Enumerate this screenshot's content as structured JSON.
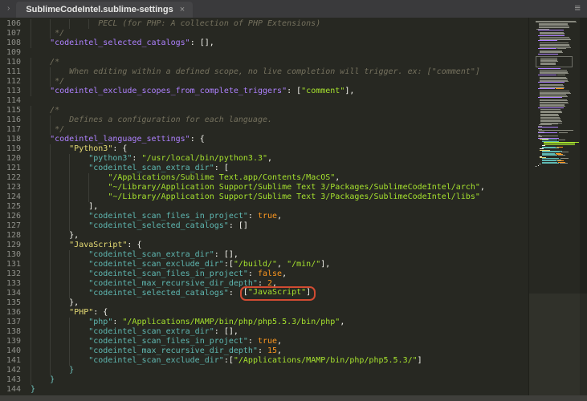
{
  "window": {
    "tab": {
      "title": "SublimeCodeIntel.sublime-settings",
      "close_glyph": "×"
    },
    "sidebar_chevron_glyph": "›",
    "overflow_icon_glyph": "≡"
  },
  "colors": {
    "editor_bg": "#272822",
    "tabbar_bg": "#3a3a3c",
    "comment": "#75715e",
    "key_top_level": "#ae81ff",
    "language_name": "#e6db74",
    "key_nested": "#5fb8b2",
    "string": "#a6e22e",
    "constant": "#fd971f",
    "punctuation": "#f8f8f2",
    "annotation_box": "#d14b32",
    "line_number": "#8f908a"
  },
  "editor": {
    "lines": [
      {
        "n": 106,
        "segs": [
          [
            "              PECL (for PHP: A collection of PHP Extensions)",
            "comment"
          ]
        ]
      },
      {
        "n": 107,
        "segs": [
          [
            "     */",
            "comment"
          ]
        ]
      },
      {
        "n": 108,
        "segs": [
          [
            "    \"codeintel_selected_catalogs\"",
            "key1"
          ],
          [
            ": [],",
            "pun"
          ]
        ]
      },
      {
        "n": 109,
        "segs": []
      },
      {
        "n": 110,
        "segs": [
          [
            "    /*",
            "comment"
          ]
        ]
      },
      {
        "n": 111,
        "segs": [
          [
            "        When editing within a defined scope, no live completion will trigger. ex: [\"comment\"]",
            "comment"
          ]
        ]
      },
      {
        "n": 112,
        "segs": [
          [
            "     */",
            "comment"
          ]
        ]
      },
      {
        "n": 113,
        "segs": [
          [
            "    \"codeintel_exclude_scopes_from_complete_triggers\"",
            "key1"
          ],
          [
            ": [",
            "pun"
          ],
          [
            "\"comment\"",
            "str"
          ],
          [
            "],",
            "pun"
          ]
        ]
      },
      {
        "n": 114,
        "segs": []
      },
      {
        "n": 115,
        "segs": [
          [
            "    /*",
            "comment"
          ]
        ]
      },
      {
        "n": 116,
        "segs": [
          [
            "        Defines a configuration for each language.",
            "comment"
          ]
        ]
      },
      {
        "n": 117,
        "segs": [
          [
            "     */",
            "comment"
          ]
        ]
      },
      {
        "n": 118,
        "segs": [
          [
            "    \"codeintel_language_settings\"",
            "key1"
          ],
          [
            ": {",
            "pun"
          ]
        ]
      },
      {
        "n": 119,
        "segs": [
          [
            "        \"Python3\"",
            "lang"
          ],
          [
            ": {",
            "pun"
          ]
        ]
      },
      {
        "n": 120,
        "segs": [
          [
            "            \"python3\"",
            "key"
          ],
          [
            ": ",
            "pun"
          ],
          [
            "\"/usr/local/bin/python3.3\"",
            "str"
          ],
          [
            ",",
            "pun"
          ]
        ]
      },
      {
        "n": 121,
        "segs": [
          [
            "            \"codeintel_scan_extra_dir\"",
            "key"
          ],
          [
            ": [",
            "pun"
          ]
        ]
      },
      {
        "n": 122,
        "segs": [
          [
            "                \"/Applications/Sublime Text.app/Contents/MacOS\"",
            "str"
          ],
          [
            ",",
            "pun"
          ]
        ]
      },
      {
        "n": 123,
        "segs": [
          [
            "                \"~/Library/Application Support/Sublime Text 3/Packages/SublimeCodeIntel/arch\"",
            "str"
          ],
          [
            ",",
            "pun"
          ]
        ]
      },
      {
        "n": 124,
        "segs": [
          [
            "                \"~/Library/Application Support/Sublime Text 3/Packages/SublimeCodeIntel/libs\"",
            "str"
          ]
        ]
      },
      {
        "n": 125,
        "segs": [
          [
            "            ],",
            "pun"
          ]
        ]
      },
      {
        "n": 126,
        "segs": [
          [
            "            \"codeintel_scan_files_in_project\"",
            "key"
          ],
          [
            ": ",
            "pun"
          ],
          [
            "true",
            "const"
          ],
          [
            ",",
            "pun"
          ]
        ]
      },
      {
        "n": 127,
        "segs": [
          [
            "            \"codeintel_selected_catalogs\"",
            "key"
          ],
          [
            ": []",
            "pun"
          ]
        ]
      },
      {
        "n": 128,
        "segs": [
          [
            "        },",
            "pun"
          ]
        ]
      },
      {
        "n": 129,
        "segs": [
          [
            "        \"JavaScript\"",
            "lang"
          ],
          [
            ": {",
            "pun"
          ]
        ]
      },
      {
        "n": 130,
        "segs": [
          [
            "            \"codeintel_scan_extra_dir\"",
            "key"
          ],
          [
            ": [],",
            "pun"
          ]
        ]
      },
      {
        "n": 131,
        "segs": [
          [
            "            \"codeintel_scan_exclude_dir\"",
            "key"
          ],
          [
            ":[",
            "pun"
          ],
          [
            "\"/build/\"",
            "str"
          ],
          [
            ", ",
            "pun"
          ],
          [
            "\"/min/\"",
            "str"
          ],
          [
            "],",
            "pun"
          ]
        ]
      },
      {
        "n": 132,
        "segs": [
          [
            "            \"codeintel_scan_files_in_project\"",
            "key"
          ],
          [
            ": ",
            "pun"
          ],
          [
            "false",
            "const"
          ],
          [
            ",",
            "pun"
          ]
        ]
      },
      {
        "n": 133,
        "segs": [
          [
            "            \"codeintel_max_recursive_dir_depth\"",
            "key"
          ],
          [
            ": ",
            "pun"
          ],
          [
            "2",
            "const"
          ],
          [
            ",",
            "pun"
          ]
        ]
      },
      {
        "n": 134,
        "boxed": [
          [
            "[",
            "pun"
          ],
          [
            "\"JavaScript\"",
            "str"
          ],
          [
            "]",
            "pun"
          ]
        ],
        "segs": [
          [
            "            \"codeintel_selected_catalogs\"",
            "key"
          ],
          [
            ": ",
            "pun"
          ]
        ]
      },
      {
        "n": 135,
        "segs": [
          [
            "        },",
            "pun"
          ]
        ]
      },
      {
        "n": 136,
        "segs": [
          [
            "        \"PHP\"",
            "lang"
          ],
          [
            ": {",
            "pun"
          ]
        ]
      },
      {
        "n": 137,
        "segs": [
          [
            "            \"php\"",
            "key"
          ],
          [
            ": ",
            "pun"
          ],
          [
            "\"/Applications/MAMP/bin/php/php5.5.3/bin/php\"",
            "str"
          ],
          [
            ",",
            "pun"
          ]
        ]
      },
      {
        "n": 138,
        "segs": [
          [
            "            \"codeintel_scan_extra_dir\"",
            "key"
          ],
          [
            ": [],",
            "pun"
          ]
        ]
      },
      {
        "n": 139,
        "segs": [
          [
            "            \"codeintel_scan_files_in_project\"",
            "key"
          ],
          [
            ": ",
            "pun"
          ],
          [
            "true",
            "const"
          ],
          [
            ",",
            "pun"
          ]
        ]
      },
      {
        "n": 140,
        "segs": [
          [
            "            \"codeintel_max_recursive_dir_depth\"",
            "key"
          ],
          [
            ": ",
            "pun"
          ],
          [
            "15",
            "const"
          ],
          [
            ",",
            "pun"
          ]
        ]
      },
      {
        "n": 141,
        "segs": [
          [
            "            \"codeintel_scan_exclude_dir\"",
            "key"
          ],
          [
            ":[",
            "pun"
          ],
          [
            "\"/Applications/MAMP/bin/php/php5.5.3/\"",
            "str"
          ],
          [
            "]",
            "pun"
          ]
        ]
      },
      {
        "n": 142,
        "segs": [
          [
            "        }",
            "brace"
          ]
        ]
      },
      {
        "n": 143,
        "segs": [
          [
            "    }",
            "brace"
          ]
        ]
      },
      {
        "n": 144,
        "segs": [
          [
            "}",
            "brace"
          ]
        ]
      }
    ]
  },
  "minimap": {
    "rows": [
      [
        2,
        "g",
        82,
        0
      ],
      [
        5,
        "g",
        58,
        6
      ],
      [
        1,
        "g",
        22,
        2
      ],
      [
        1,
        "p",
        46,
        4
      ],
      [
        1,
        "x",
        0,
        0
      ],
      [
        3,
        "g",
        50,
        8
      ],
      [
        1,
        "p",
        52,
        4
      ],
      [
        1,
        "x",
        0,
        0
      ],
      [
        3,
        "g",
        56,
        8
      ],
      [
        1,
        "p",
        42,
        4
      ],
      [
        1,
        "x",
        0,
        0
      ],
      [
        5,
        "g",
        58,
        8
      ],
      [
        1,
        "pg",
        56,
        4
      ],
      [
        1,
        "x",
        0,
        0
      ],
      [
        3,
        "g",
        47,
        8
      ],
      [
        1,
        "p",
        40,
        4
      ],
      [
        1,
        "x",
        0,
        0
      ],
      [
        7,
        "gb",
        50,
        8
      ],
      [
        1,
        "p",
        46,
        4
      ],
      [
        1,
        "x",
        0,
        0
      ],
      [
        4,
        "g",
        52,
        8
      ],
      [
        1,
        "pg",
        62,
        4
      ],
      [
        1,
        "x",
        0,
        0
      ],
      [
        5,
        "g",
        54,
        8
      ],
      [
        1,
        "p",
        50,
        4
      ],
      [
        1,
        "x",
        0,
        0
      ],
      [
        4,
        "g",
        49,
        8
      ],
      [
        1,
        "po",
        54,
        4
      ],
      [
        1,
        "x",
        0,
        0
      ],
      [
        6,
        "g",
        56,
        8
      ],
      [
        1,
        "p",
        48,
        4
      ],
      [
        1,
        "x",
        0,
        0
      ],
      [
        7,
        "g",
        52,
        8
      ],
      [
        1,
        "p",
        52,
        4
      ],
      [
        1,
        "x",
        0,
        0
      ],
      [
        14,
        "g",
        38,
        10
      ],
      [
        1,
        "g",
        28,
        6
      ],
      [
        1,
        "g",
        10,
        4
      ],
      [
        1,
        "p",
        40,
        4
      ],
      [
        1,
        "x",
        0,
        0
      ],
      [
        1,
        "g",
        8,
        4
      ],
      [
        1,
        "g",
        64,
        7
      ],
      [
        1,
        "g",
        10,
        4
      ],
      [
        1,
        "pg",
        58,
        4
      ],
      [
        1,
        "x",
        0,
        0
      ],
      [
        1,
        "g",
        8,
        4
      ],
      [
        1,
        "g",
        40,
        6
      ],
      [
        1,
        "g",
        10,
        4
      ],
      [
        1,
        "p",
        42,
        4
      ],
      [
        1,
        "y",
        16,
        8
      ],
      [
        1,
        "cg",
        46,
        12
      ],
      [
        1,
        "c",
        30,
        12
      ],
      [
        3,
        "gr",
        64,
        16
      ],
      [
        1,
        "w",
        8,
        12
      ],
      [
        1,
        "co",
        44,
        12
      ],
      [
        1,
        "c",
        34,
        12
      ],
      [
        1,
        "w",
        6,
        8
      ],
      [
        1,
        "y",
        18,
        8
      ],
      [
        1,
        "c",
        36,
        12
      ],
      [
        1,
        "cg",
        52,
        12
      ],
      [
        1,
        "co",
        44,
        12
      ],
      [
        1,
        "co",
        46,
        12
      ],
      [
        1,
        "cg",
        50,
        12
      ],
      [
        1,
        "w",
        6,
        8
      ],
      [
        1,
        "y",
        12,
        8
      ],
      [
        1,
        "cg",
        54,
        12
      ],
      [
        1,
        "c",
        36,
        12
      ],
      [
        1,
        "co",
        42,
        12
      ],
      [
        1,
        "co",
        44,
        12
      ],
      [
        1,
        "cg",
        58,
        12
      ],
      [
        1,
        "w",
        5,
        8
      ],
      [
        1,
        "w",
        4,
        4
      ],
      [
        1,
        "w",
        3,
        0
      ]
    ]
  }
}
